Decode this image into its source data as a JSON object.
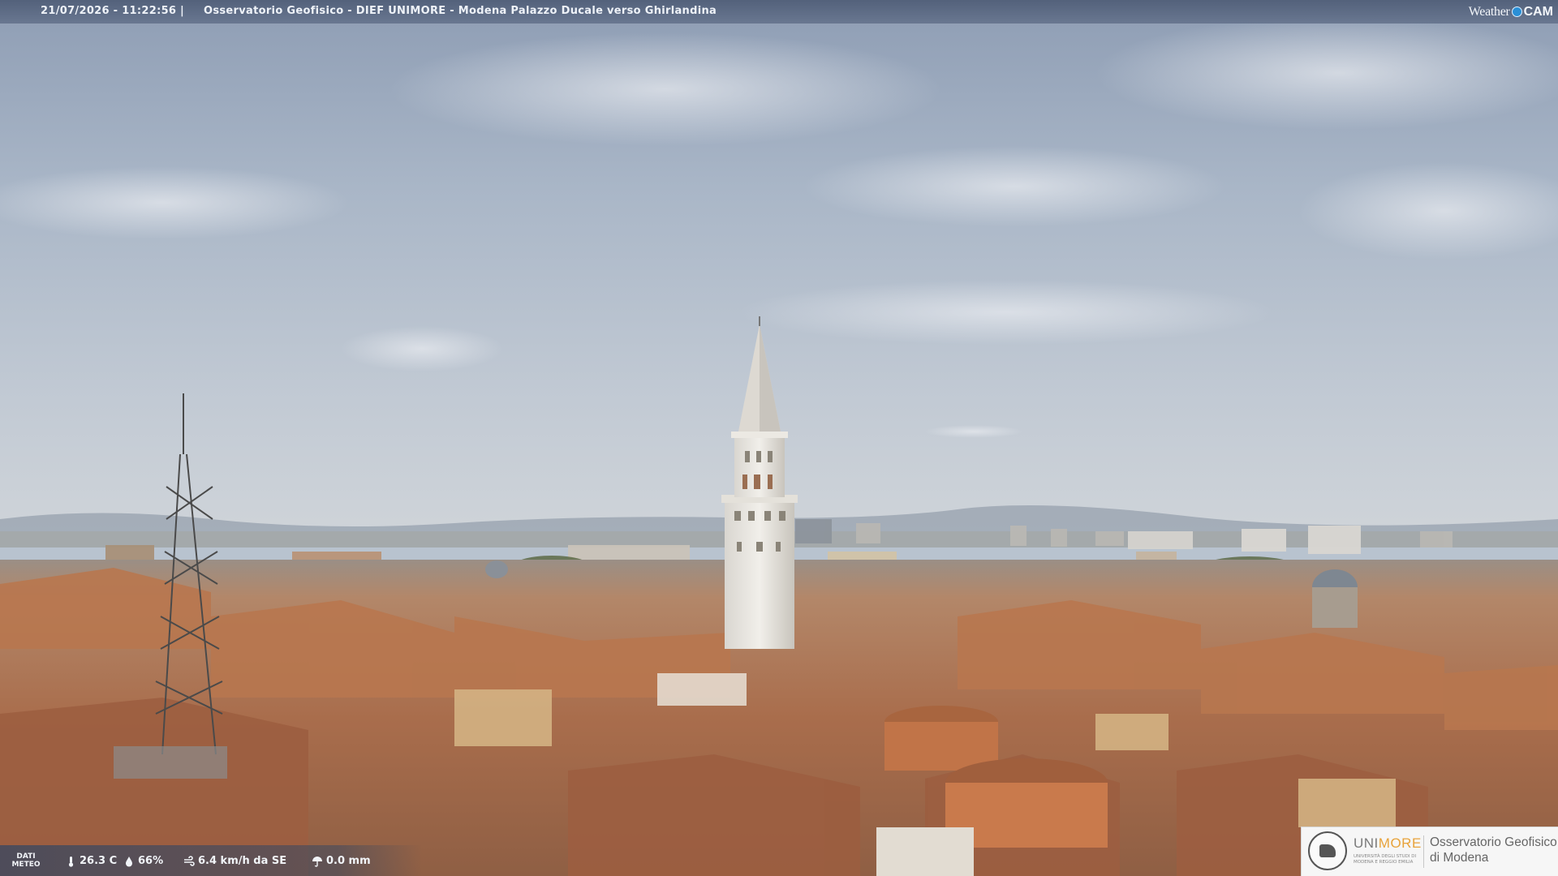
{
  "banner": {
    "timestamp": "21/07/2026 - 11:22:56",
    "separator": "|",
    "title": "Osservatorio Geofisico - DIEF UNIMORE - Modena Palazzo Ducale verso Ghirlandina"
  },
  "brand": {
    "word1": "Weather",
    "word2": "CAM",
    "dot_color": "#2a8fd6"
  },
  "meteo": {
    "label": "DATI METEO",
    "temperature": "26.3 C",
    "humidity": "66%",
    "wind": "6.4 km/h da SE",
    "rain": "0.0 mm",
    "icons": [
      "thermometer-icon",
      "humidity-drop-icon",
      "wind-icon",
      "rain-umbrella-icon"
    ]
  },
  "logo": {
    "uni_gray": "UNI",
    "uni_accent": "MORE",
    "uni_sub": "UNIVERSITÀ DEGLI STUDI DI MODENA E REGGIO EMILIA",
    "obs_line1": "Osservatorio Geofisico",
    "obs_line2": "di Modena"
  }
}
